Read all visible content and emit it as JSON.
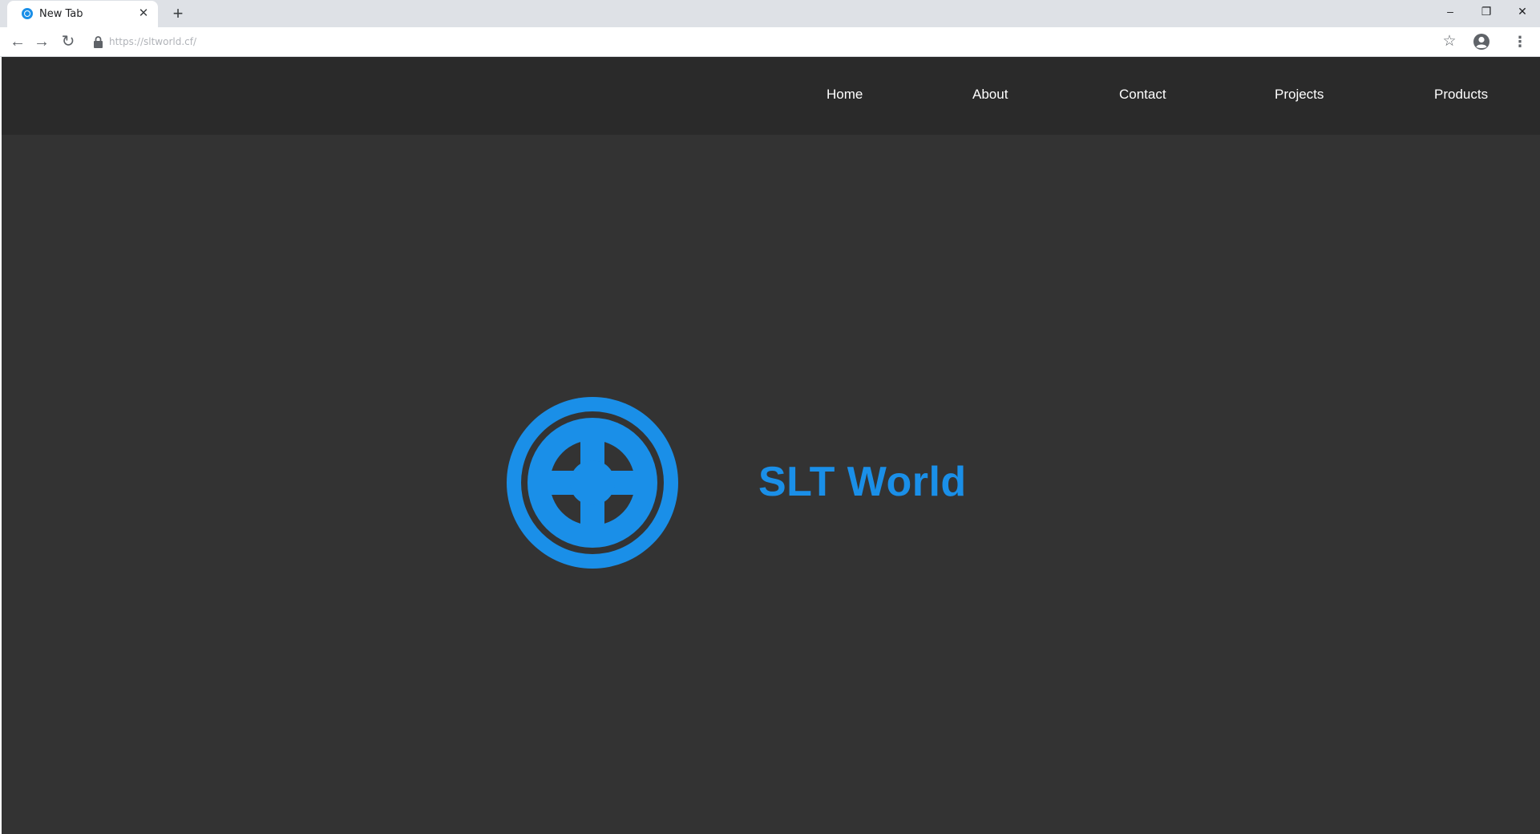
{
  "browser": {
    "tab": {
      "title": "New Tab",
      "close_glyph": "✕",
      "favicon_icon": "slt-logo-icon"
    },
    "new_tab_glyph": "+",
    "window_controls": {
      "minimize": "–",
      "maximize": "❐",
      "close": "✕"
    },
    "toolbar": {
      "back_glyph": "←",
      "forward_glyph": "→",
      "reload_glyph": "↻",
      "url": "https://sltworld.cf/",
      "bookmark_glyph": "☆",
      "menu_glyph": "⋮"
    }
  },
  "page": {
    "nav": {
      "items": [
        {
          "label": "Home"
        },
        {
          "label": "About"
        },
        {
          "label": "Contact"
        },
        {
          "label": "Projects"
        },
        {
          "label": "Products"
        }
      ]
    },
    "hero": {
      "title": "SLT World",
      "logo_icon": "slt-logo-icon"
    }
  },
  "colors": {
    "page_background": "#333333",
    "navbar_background": "#2a2a2a",
    "accent": "#1a8fe8",
    "nav_text": "#ffffff",
    "tabstrip": "#dee1e6"
  }
}
